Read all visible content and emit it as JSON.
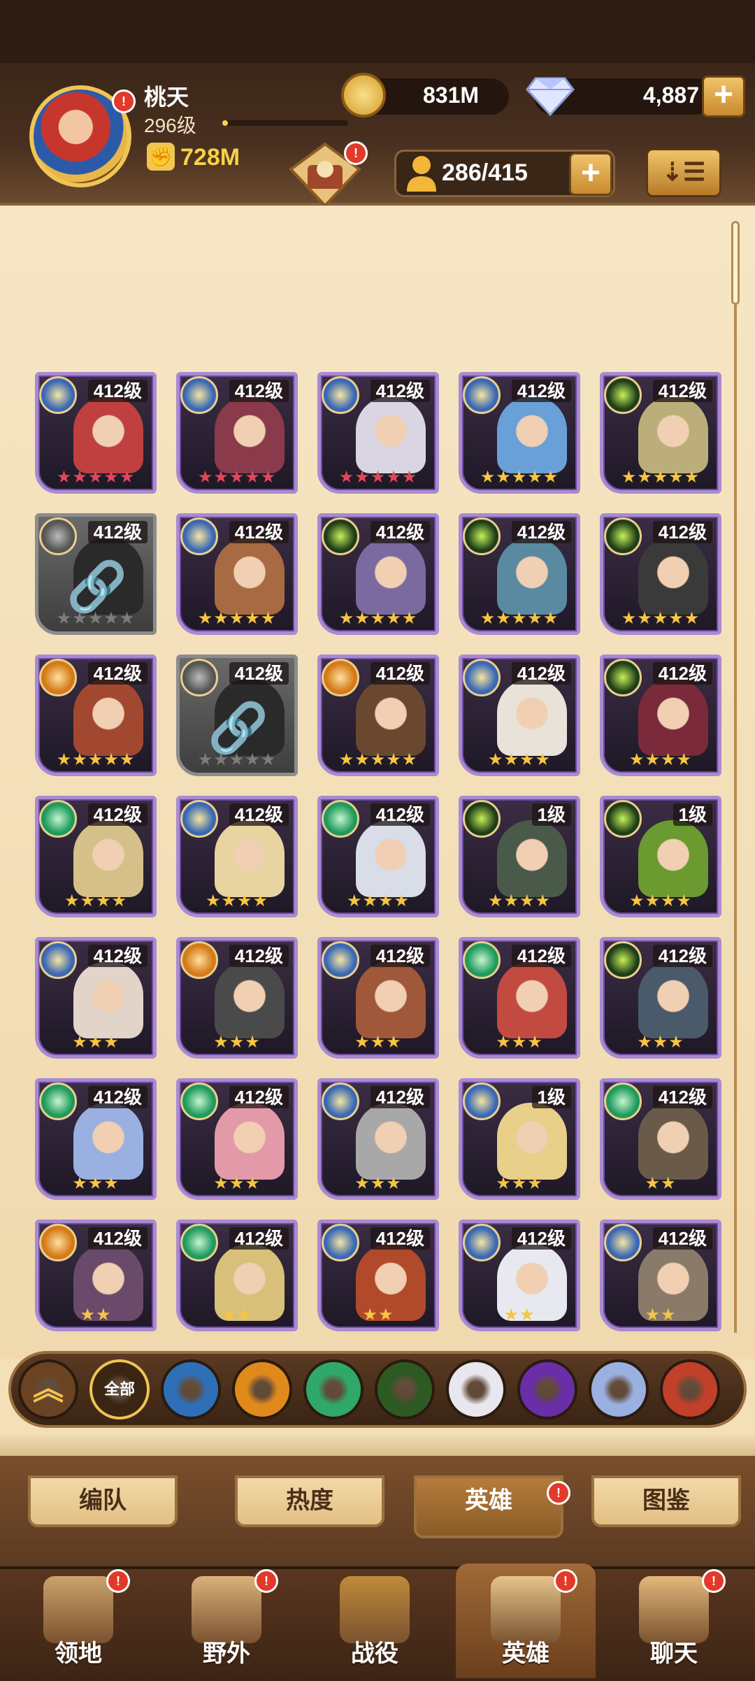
{
  "player": {
    "name": "桃天",
    "level": "296级",
    "power": "728M",
    "xp_progress": 0.04
  },
  "currency": {
    "gold": "831M",
    "gems": "4,887",
    "plus": "+"
  },
  "hero_slots": {
    "value": "286/415",
    "plus": "+"
  },
  "badges": {
    "alert": "!"
  },
  "sort_icon": "sort-icon",
  "colors": {
    "stars_red": "#e5475a",
    "stars_gold": "#f6c642",
    "card_border": "#a98ad2",
    "header_bg": "#3a2618"
  },
  "heroes": [
    {
      "level": "412级",
      "stars": "★★★★★",
      "star_color": "red",
      "faction": "lightbearer",
      "locked": false
    },
    {
      "level": "412级",
      "stars": "★★★★★",
      "star_color": "red",
      "faction": "lightbearer",
      "locked": false
    },
    {
      "level": "412级",
      "stars": "★★★★★",
      "star_color": "red",
      "faction": "lightbearer",
      "locked": false
    },
    {
      "level": "412级",
      "stars": "★★★★★",
      "star_color": "gold",
      "faction": "lightbearer",
      "locked": false
    },
    {
      "level": "412级",
      "stars": "★★★★★",
      "star_color": "gold",
      "faction": "graveborn",
      "locked": false
    },
    {
      "level": "412级",
      "stars": "★★★★★",
      "star_color": "grey",
      "faction": "lightbearer",
      "locked": true
    },
    {
      "level": "412级",
      "stars": "★★★★★",
      "star_color": "gold",
      "faction": "lightbearer",
      "locked": false
    },
    {
      "level": "412级",
      "stars": "★★★★★",
      "star_color": "gold",
      "faction": "graveborn",
      "locked": false
    },
    {
      "level": "412级",
      "stars": "★★★★★",
      "star_color": "gold",
      "faction": "graveborn",
      "locked": false
    },
    {
      "level": "412级",
      "stars": "★★★★★",
      "star_color": "gold",
      "faction": "graveborn",
      "locked": false
    },
    {
      "level": "412级",
      "stars": "★★★★★",
      "star_color": "gold",
      "faction": "maulers",
      "locked": false
    },
    {
      "level": "412级",
      "stars": "★★★★★",
      "star_color": "grey",
      "faction": "maulers",
      "locked": true
    },
    {
      "level": "412级",
      "stars": "★★★★★",
      "star_color": "gold",
      "faction": "maulers",
      "locked": false
    },
    {
      "level": "412级",
      "stars": "★★★★",
      "star_color": "gold",
      "faction": "lightbearer",
      "locked": false
    },
    {
      "level": "412级",
      "stars": "★★★★",
      "star_color": "gold",
      "faction": "graveborn",
      "locked": false
    },
    {
      "level": "412级",
      "stars": "★★★★",
      "star_color": "gold",
      "faction": "wilder",
      "locked": false
    },
    {
      "level": "412级",
      "stars": "★★★★",
      "star_color": "gold",
      "faction": "lightbearer",
      "locked": false
    },
    {
      "level": "412级",
      "stars": "★★★★",
      "star_color": "gold",
      "faction": "wilder",
      "locked": false
    },
    {
      "level": "1级",
      "stars": "★★★★",
      "star_color": "gold",
      "faction": "graveborn",
      "locked": false
    },
    {
      "level": "1级",
      "stars": "★★★★",
      "star_color": "gold",
      "faction": "graveborn",
      "locked": false
    },
    {
      "level": "412级",
      "stars": "★★★",
      "star_color": "gold",
      "faction": "lightbearer",
      "locked": false
    },
    {
      "level": "412级",
      "stars": "★★★",
      "star_color": "gold",
      "faction": "maulers",
      "locked": false
    },
    {
      "level": "412级",
      "stars": "★★★",
      "star_color": "gold",
      "faction": "lightbearer",
      "locked": false
    },
    {
      "level": "412级",
      "stars": "★★★",
      "star_color": "gold",
      "faction": "wilder",
      "locked": false
    },
    {
      "level": "412级",
      "stars": "★★★",
      "star_color": "gold",
      "faction": "graveborn",
      "locked": false
    },
    {
      "level": "412级",
      "stars": "★★★",
      "star_color": "gold",
      "faction": "wilder",
      "locked": false
    },
    {
      "level": "412级",
      "stars": "★★★",
      "star_color": "gold",
      "faction": "wilder",
      "locked": false
    },
    {
      "level": "412级",
      "stars": "★★★",
      "star_color": "gold",
      "faction": "lightbearer",
      "locked": false
    },
    {
      "level": "1级",
      "stars": "★★★",
      "star_color": "gold",
      "faction": "lightbearer",
      "locked": false
    },
    {
      "level": "412级",
      "stars": "★★",
      "star_color": "gold",
      "faction": "wilder",
      "locked": false
    },
    {
      "level": "412级",
      "stars": "★★",
      "star_color": "gold",
      "faction": "maulers",
      "locked": false
    },
    {
      "level": "412级",
      "stars": "★★",
      "star_color": "gold",
      "faction": "wilder",
      "locked": false
    },
    {
      "level": "412级",
      "stars": "★★",
      "star_color": "gold",
      "faction": "lightbearer",
      "locked": false
    },
    {
      "level": "412级",
      "stars": "★★",
      "star_color": "gold",
      "faction": "lightbearer",
      "locked": false
    },
    {
      "level": "412级",
      "stars": "★★",
      "star_color": "gold",
      "faction": "lightbearer",
      "locked": false
    }
  ],
  "filters": [
    {
      "name": "collapse",
      "label": "",
      "icon": "chevron-up-icon",
      "color": "#6a4322"
    },
    {
      "name": "all",
      "label": "全部",
      "icon": "",
      "color": "#3a2412"
    },
    {
      "name": "lightbearer",
      "label": "",
      "icon": "lightbearer-faction-icon",
      "color": "#2f6fb8"
    },
    {
      "name": "maulers",
      "label": "",
      "icon": "maulers-faction-icon",
      "color": "#e08a1c"
    },
    {
      "name": "wilder",
      "label": "",
      "icon": "wilder-faction-icon",
      "color": "#2fa86a"
    },
    {
      "name": "graveborn",
      "label": "",
      "icon": "graveborn-faction-icon",
      "color": "#2d5a22"
    },
    {
      "name": "celestial",
      "label": "",
      "icon": "celestial-faction-icon",
      "color": "#e8e6ef"
    },
    {
      "name": "hypogean",
      "label": "",
      "icon": "hypogean-faction-icon",
      "color": "#6a2ea8"
    },
    {
      "name": "dimensional",
      "label": "",
      "icon": "dimensional-faction-icon",
      "color": "#9ab0e0"
    },
    {
      "name": "draconis",
      "label": "",
      "icon": "draconis-faction-icon",
      "color": "#c0402a"
    }
  ],
  "subtabs": [
    {
      "label": "编队",
      "active": false
    },
    {
      "label": "热度",
      "active": false
    },
    {
      "label": "英雄",
      "active": true
    },
    {
      "label": "图鉴",
      "active": false
    }
  ],
  "nav": [
    {
      "label": "领地",
      "icon": "castle-icon",
      "badge": true,
      "active": false
    },
    {
      "label": "野外",
      "icon": "scroll-map-icon",
      "badge": true,
      "active": false
    },
    {
      "label": "战役",
      "icon": "battle-sword-icon",
      "badge": false,
      "active": false
    },
    {
      "label": "英雄",
      "icon": "hero-helmet-icon",
      "badge": true,
      "active": true
    },
    {
      "label": "聊天",
      "icon": "chat-icon",
      "badge": true,
      "active": false
    }
  ]
}
